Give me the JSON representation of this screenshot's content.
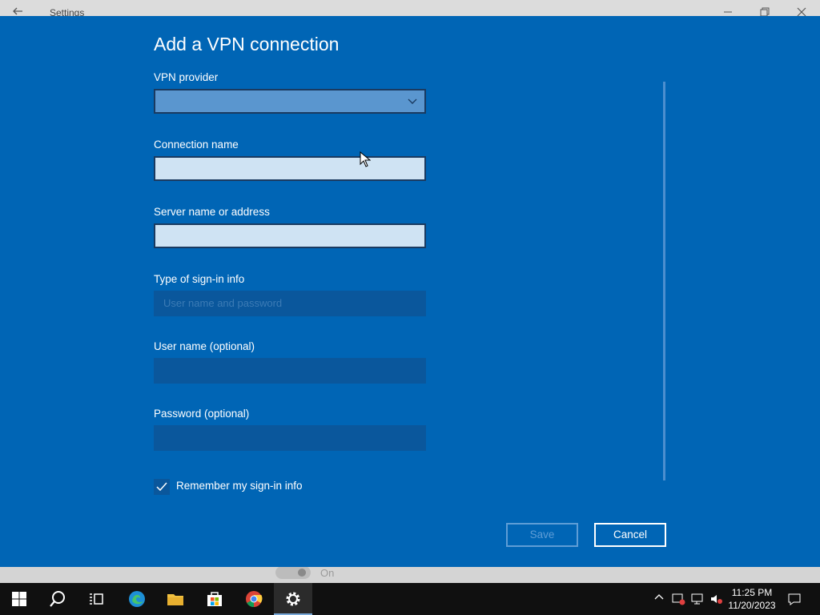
{
  "background_window": {
    "title": "Settings",
    "toggle_label": "On"
  },
  "dialog": {
    "title": "Add a VPN connection",
    "fields": {
      "vpn_provider": {
        "label": "VPN provider",
        "value": ""
      },
      "connection_name": {
        "label": "Connection name",
        "value": ""
      },
      "server": {
        "label": "Server name or address",
        "value": ""
      },
      "signin_type": {
        "label": "Type of sign-in info",
        "value": "User name and password"
      },
      "username": {
        "label": "User name (optional)",
        "value": ""
      },
      "password": {
        "label": "Password (optional)",
        "value": ""
      }
    },
    "remember": {
      "label": "Remember my sign-in info",
      "checked": true
    },
    "buttons": {
      "save": "Save",
      "cancel": "Cancel"
    }
  },
  "taskbar": {
    "pinned": [
      "start-icon",
      "search-icon",
      "task-view-icon",
      "edge-icon",
      "file-explorer-icon",
      "store-icon",
      "chrome-icon",
      "settings-icon"
    ],
    "clock": {
      "time": "11:25 PM",
      "date": "11/20/2023"
    }
  },
  "colors": {
    "dialog_bg": "#0065b5",
    "taskbar_bg": "#101010"
  }
}
